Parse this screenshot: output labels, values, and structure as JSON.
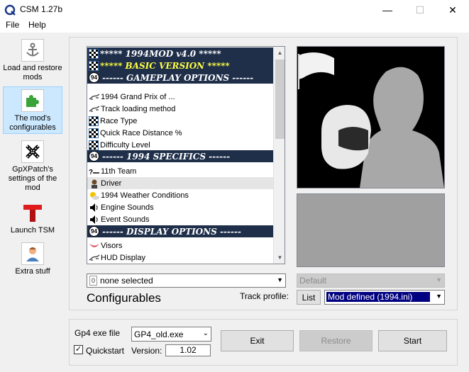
{
  "window": {
    "title": "CSM 1.27b",
    "minimize_glyph": "—",
    "maximize_glyph": "☐",
    "close_glyph": "✕"
  },
  "menu": [
    "File",
    "Help"
  ],
  "nav": [
    {
      "label": "Load and restore mods",
      "icon": "anchor-icon"
    },
    {
      "label": "The mod's configurables",
      "icon": "puzzle-piece-icon",
      "selected": true
    },
    {
      "label": "GpXPatch's settings of the mod",
      "icon": "gpxpatch-icon"
    },
    {
      "label": "Launch TSM",
      "icon": "tsm-icon"
    },
    {
      "label": "Extra stuff",
      "icon": "user-icon"
    }
  ],
  "list": [
    {
      "label": "***** 1994MOD v4.0 *****",
      "type": "title"
    },
    {
      "label": "***** BASIC VERSION *****",
      "type": "title-yellow"
    },
    {
      "label": "------ GAMEPLAY OPTIONS ------",
      "type": "section"
    },
    {
      "label": "1994 Grand Prix of ...",
      "icon": "race-car-icon"
    },
    {
      "label": "Track loading method",
      "icon": "race-car-icon"
    },
    {
      "label": "Race Type",
      "icon": "checkered-flag-icon"
    },
    {
      "label": "Quick Race Distance %",
      "icon": "checkered-flag-icon"
    },
    {
      "label": "Difficulty Level",
      "icon": "checkered-flag-icon"
    },
    {
      "label": "------ 1994 SPECIFICS ------",
      "type": "section"
    },
    {
      "label": "11th Team",
      "icon": "question-car-icon"
    },
    {
      "label": "Driver",
      "icon": "driver-icon",
      "hover": true
    },
    {
      "label": "1994 Weather Conditions",
      "icon": "weather-icon"
    },
    {
      "label": "Engine Sounds",
      "icon": "speaker-icon"
    },
    {
      "label": "Event Sounds",
      "icon": "speaker-icon"
    },
    {
      "label": "------ DISPLAY OPTIONS ------",
      "type": "section"
    },
    {
      "label": "Visors",
      "icon": "visor-icon"
    },
    {
      "label": "HUD Display",
      "icon": "race-car-icon"
    }
  ],
  "badge_text": "94",
  "config_select": {
    "prefix": "0",
    "value": "none selected"
  },
  "preset_select": {
    "value": "Default"
  },
  "configurables_label": "Configurables",
  "track_profile_label": "Track profile:",
  "list_button": "List",
  "track_profile_select": {
    "value": "Mod defined (1994.ini)"
  },
  "bottom": {
    "exe_label": "Gp4 exe file",
    "exe_value": "GP4_old.exe",
    "quickstart_label": "Quickstart",
    "quickstart_checked": true,
    "version_label": "Version:",
    "version_value": "1.02",
    "exit_button": "Exit",
    "restore_button": "Restore",
    "start_button": "Start"
  }
}
